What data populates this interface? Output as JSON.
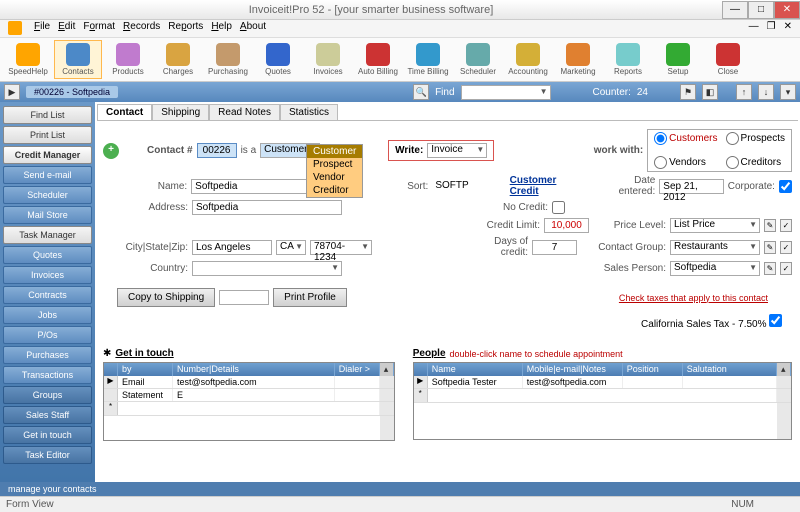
{
  "window": {
    "title": "Invoiceit!Pro 52 - [your smarter business software]"
  },
  "menu": [
    "File",
    "Edit",
    "Format",
    "Records",
    "Reports",
    "Help",
    "About"
  ],
  "toolbar": [
    {
      "label": "SpeedHelp",
      "color": "#ffa500"
    },
    {
      "label": "Contacts",
      "color": "#4c89c8",
      "active": true
    },
    {
      "label": "Products",
      "color": "#c07bce"
    },
    {
      "label": "Charges",
      "color": "#d9a441"
    },
    {
      "label": "Purchasing",
      "color": "#c49a6c"
    },
    {
      "label": "Quotes",
      "color": "#36c"
    },
    {
      "label": "Invoices",
      "color": "#cc9"
    },
    {
      "label": "Auto Billing",
      "color": "#c33"
    },
    {
      "label": "Time Billing",
      "color": "#39c"
    },
    {
      "label": "Scheduler",
      "color": "#6aa"
    },
    {
      "label": "Accounting",
      "color": "#d4af37"
    },
    {
      "label": "Marketing",
      "color": "#e08030"
    },
    {
      "label": "Reports",
      "color": "#7cc"
    },
    {
      "label": "Setup",
      "color": "#3a3"
    },
    {
      "label": "Close",
      "color": "#c33"
    }
  ],
  "subbar": {
    "record": "#00226 - Softpedia",
    "find_label": "Find",
    "counter_label": "Counter:",
    "counter": "24"
  },
  "sidebar": [
    {
      "label": "Find List",
      "cls": ""
    },
    {
      "label": "Print List",
      "cls": ""
    },
    {
      "label": "Credit Manager",
      "cls": "active"
    },
    {
      "label": "Send e-mail",
      "cls": "blue"
    },
    {
      "label": "Scheduler",
      "cls": "blue"
    },
    {
      "label": "Mail Store",
      "cls": "blue"
    },
    {
      "label": "Task Manager",
      "cls": ""
    },
    {
      "label": "Quotes",
      "cls": "blue"
    },
    {
      "label": "Invoices",
      "cls": "blue"
    },
    {
      "label": "Contracts",
      "cls": "blue"
    },
    {
      "label": "Jobs",
      "cls": "blue"
    },
    {
      "label": "P/Os",
      "cls": "blue"
    },
    {
      "label": "Purchases",
      "cls": "blue"
    },
    {
      "label": "Transactions",
      "cls": "blue"
    },
    {
      "label": "Groups",
      "cls": "dark"
    },
    {
      "label": "Sales Staff",
      "cls": "dark"
    },
    {
      "label": "Get in touch",
      "cls": "dark"
    },
    {
      "label": "Task Editor",
      "cls": "dark"
    }
  ],
  "tabs": [
    "Contact",
    "Shipping",
    "Read Notes",
    "Statistics"
  ],
  "form": {
    "contact_num_label": "Contact #",
    "contact_num": "00226",
    "is_a": "is a",
    "type": "Customer",
    "type_options": [
      "Customer",
      "Prospect",
      "Vendor",
      "Creditor"
    ],
    "name_label": "Name:",
    "name": "Softpedia",
    "address_label": "Address:",
    "address": "Softpedia",
    "csz_label": "City|State|Zip:",
    "city": "Los Angeles",
    "state": "CA",
    "zip": "78704-1234",
    "country_label": "Country:",
    "country": "",
    "sort_label": "Sort:",
    "sort": "SOFTP",
    "write_label": "Write:",
    "write_val": "Invoice",
    "workwith_label": "work with:",
    "workwith": [
      "Customers",
      "Prospects",
      "Vendors",
      "Creditors"
    ],
    "date_label": "Date entered:",
    "date": "Sep 21, 2012",
    "corporate_label": "Corporate:",
    "credit_header": "Customer Credit",
    "no_credit": "No Credit:",
    "credit_limit_label": "Credit Limit:",
    "credit_limit": "10,000",
    "days_credit_label": "Days of credit:",
    "days_credit": "7",
    "price_level_label": "Price Level:",
    "price_level": "List Price",
    "contact_group_label": "Contact Group:",
    "contact_group": "Restaurants",
    "sales_person_label": "Sales Person:",
    "sales_person": "Softpedia",
    "copy_btn": "Copy to Shipping",
    "print_btn": "Print Profile",
    "check_taxes": "Check taxes that apply to this contact",
    "tax_line": "California Sales Tax - 7.50%"
  },
  "touch": {
    "title": "Get in touch",
    "cols": [
      "by",
      "Number|Details",
      "Dialer >"
    ],
    "rows": [
      {
        "by": "Email",
        "detail": "test@softpedia.com"
      },
      {
        "by": "Statement",
        "detail": "E"
      }
    ]
  },
  "people": {
    "title": "People",
    "hint": "double-click name to schedule appointment",
    "cols": [
      "Name",
      "Mobile|e-mail|Notes",
      "Position",
      "Salutation"
    ],
    "rows": [
      {
        "name": "Softpedia Tester",
        "contact": "test@softpedia.com"
      }
    ]
  },
  "footer_hint": "manage your contacts",
  "status": {
    "left": "Form View",
    "num": "NUM"
  }
}
